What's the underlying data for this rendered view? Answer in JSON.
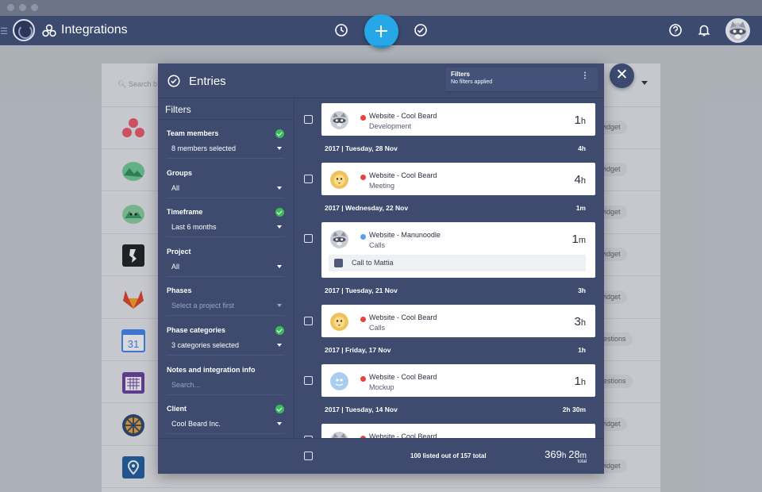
{
  "app": {
    "title": "Integrations",
    "icons": [
      "history-icon",
      "add-icon",
      "entries-icon",
      "help-icon",
      "notifications-icon",
      "user-avatar"
    ]
  },
  "background": {
    "search_placeholder": "Search b",
    "rows": [
      {
        "icon": "asana-logo-icon",
        "pill": "r widget"
      },
      {
        "icon": "basecamp-logo-icon",
        "pill": "r widget"
      },
      {
        "icon": "basecamp-2-logo-icon",
        "pill": "r widget"
      },
      {
        "icon": "dark-app-logo-icon",
        "pill": "r widget"
      },
      {
        "icon": "gitlab-logo-icon",
        "pill": "r widget"
      },
      {
        "icon": "google-calendar-logo-icon",
        "pill": "ggestions"
      },
      {
        "icon": "calendar-app-logo-icon",
        "pill": "ggestions"
      },
      {
        "icon": "orange-app-logo-icon",
        "pill": "r widget"
      },
      {
        "icon": "pin-app-logo-icon",
        "pill": "r widget"
      }
    ]
  },
  "modal": {
    "title": "Entries",
    "filters_summary": {
      "title": "Filters",
      "subtitle": "No filters applied"
    },
    "sidebar": {
      "title": "Filters",
      "groups": [
        {
          "label": "Team members",
          "value": "8 members selected",
          "active": true,
          "dim": false
        },
        {
          "label": "Groups",
          "value": "All",
          "active": false,
          "dim": false
        },
        {
          "label": "Timeframe",
          "value": "Last 6 months",
          "active": true,
          "dim": false
        },
        {
          "label": "Project",
          "value": "All",
          "active": false,
          "dim": false
        },
        {
          "label": "Phases",
          "value": "Select a project first",
          "active": false,
          "dim": true
        },
        {
          "label": "Phase categories",
          "value": "3 categories selected",
          "active": true,
          "dim": false
        },
        {
          "label": "Notes and integration info",
          "value": "Search...",
          "active": false,
          "dim": true
        },
        {
          "label": "Client",
          "value": "Cool Beard Inc.",
          "active": true,
          "dim": false
        }
      ]
    },
    "entries": [
      {
        "kind": "card",
        "project": "Website - Cool Beard",
        "phase": "Development",
        "hours": "1",
        "unit": "h",
        "dot": "#e8423f",
        "avatar": "raccoon"
      },
      {
        "kind": "day",
        "date": "2017 | Tuesday, 28 Nov",
        "total": "4h"
      },
      {
        "kind": "card",
        "project": "Website - Cool Beard",
        "phase": "Meeting",
        "hours": "4",
        "unit": "h",
        "dot": "#e8423f",
        "avatar": "lion"
      },
      {
        "kind": "day",
        "date": "2017 | Wednesday, 22 Nov",
        "total": "1m"
      },
      {
        "kind": "card",
        "project": "Website - Manunoodle",
        "phase": "Calls",
        "hours": "1",
        "unit": "m",
        "dot": "#5b9fe8",
        "avatar": "raccoon",
        "note": "Call to Mattia"
      },
      {
        "kind": "day",
        "date": "2017 | Tuesday, 21 Nov",
        "total": "3h"
      },
      {
        "kind": "card",
        "project": "Website - Cool Beard",
        "phase": "Calls",
        "hours": "3",
        "unit": "h",
        "dot": "#e8423f",
        "avatar": "lion"
      },
      {
        "kind": "day",
        "date": "2017 | Friday, 17 Nov",
        "total": "1h"
      },
      {
        "kind": "card",
        "project": "Website - Cool Beard",
        "phase": "Mockup",
        "hours": "1",
        "unit": "h",
        "dot": "#e8423f",
        "avatar": "ghost"
      },
      {
        "kind": "day",
        "date": "2017 | Tuesday, 14 Nov",
        "total": "2h 30m"
      },
      {
        "kind": "card",
        "project": "Website - Cool Beard",
        "phase": "",
        "hours": "",
        "unit": "",
        "dot": "#e8423f",
        "avatar": "raccoon"
      }
    ],
    "footer": {
      "count_text": "100 listed out of 157 total",
      "total_h": "369",
      "total_m": "28",
      "total_label": "total"
    }
  }
}
